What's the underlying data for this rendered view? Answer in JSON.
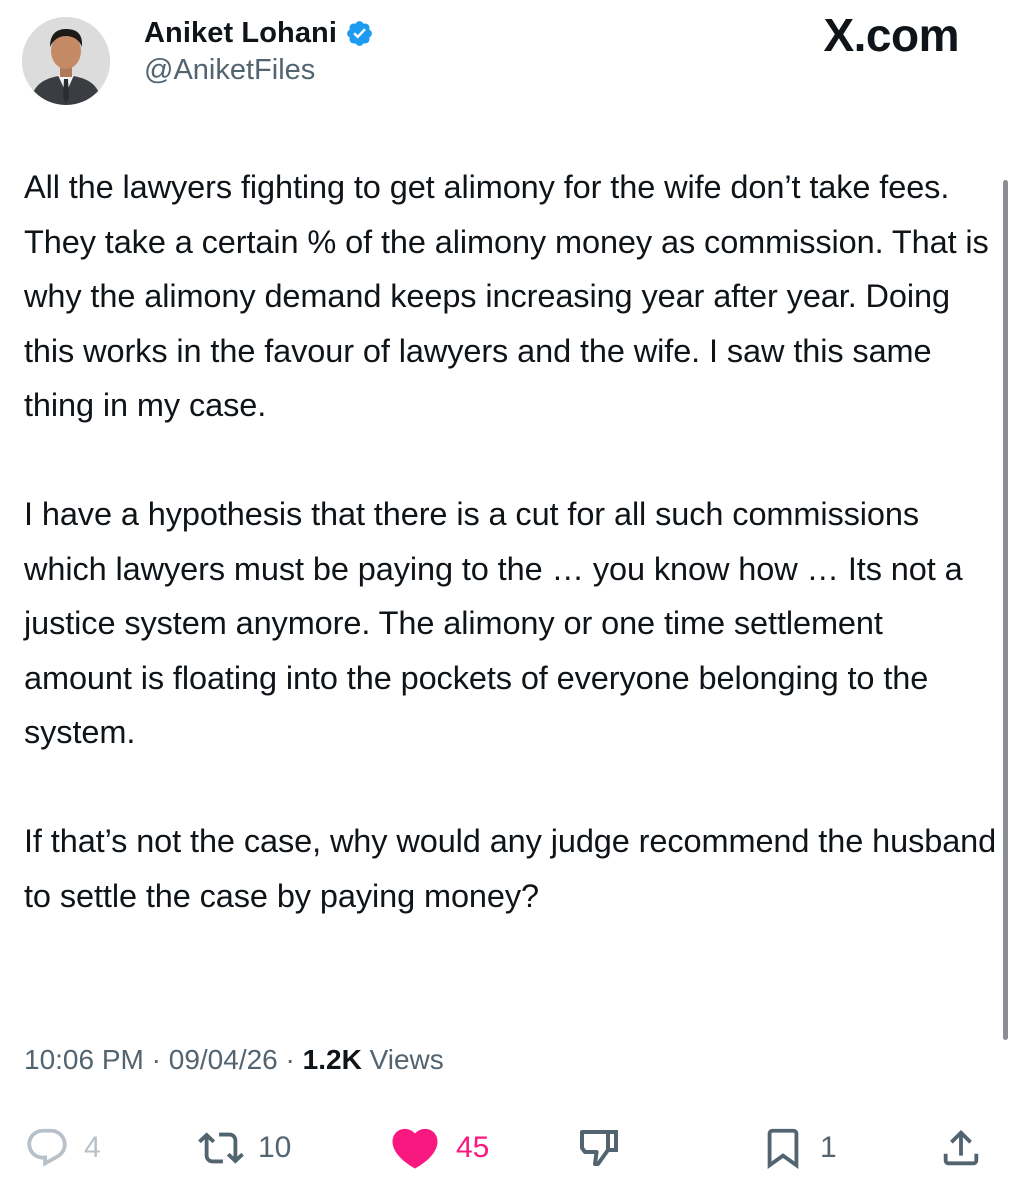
{
  "author": {
    "display_name": "Aniket Lohani",
    "handle": "@AniketFiles",
    "verified": true,
    "verified_icon": "verified-badge-icon",
    "verified_color": "#1d9bf0"
  },
  "brand": {
    "label": "X.com"
  },
  "tweet": {
    "paragraphs": [
      "All the lawyers fighting to get alimony for the wife don’t take fees. They take a certain % of the alimony money as commission. That is why the alimony demand keeps increasing year after year. Doing this works in the favour of lawyers and the wife. I saw this same thing in my case.",
      "I have a hypothesis that there is a cut for all such commissions which lawyers must be paying to the … you know how … Its not a justice system anymore. The alimony or one time settlement amount is floating into the pockets of everyone belonging to the system.",
      "If that’s not the case, why would any judge recommend the husband to settle the case by paying money?"
    ]
  },
  "meta": {
    "time": "10:06 PM",
    "date": "09/04/26",
    "separator": " · ",
    "views_count": "1.2K",
    "views_label": "Views"
  },
  "actions": {
    "reply": {
      "icon": "reply-icon",
      "count": "4"
    },
    "retweet": {
      "icon": "retweet-icon",
      "count": "10"
    },
    "like": {
      "icon": "heart-icon",
      "count": "45",
      "active": true,
      "color": "#f91880"
    },
    "dislike": {
      "icon": "thumbs-down-icon"
    },
    "bookmark": {
      "icon": "bookmark-icon",
      "count": "1"
    },
    "share": {
      "icon": "share-icon"
    }
  },
  "colors": {
    "text": "#0f1419",
    "muted": "#536471",
    "reply_muted": "#b8c1c9",
    "like": "#f91880"
  }
}
